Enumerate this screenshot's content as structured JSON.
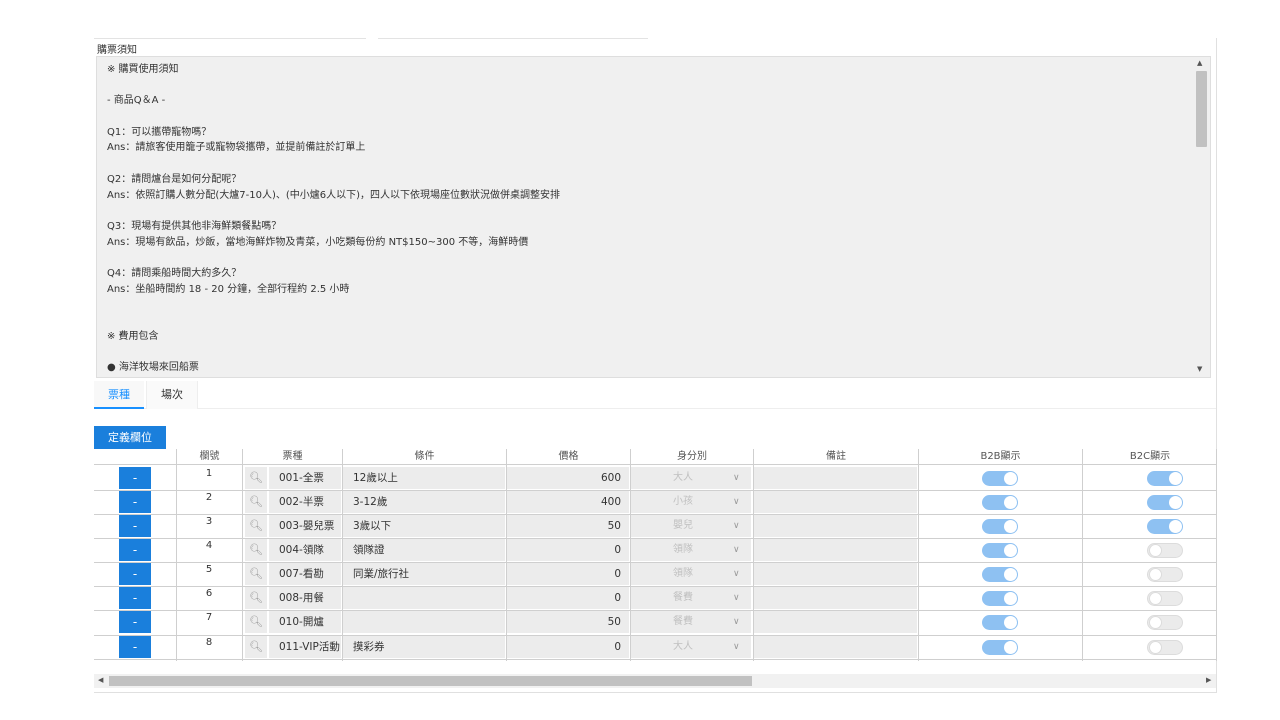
{
  "notice": {
    "label": "購票須知",
    "lines": [
      "※ 購買使用須知",
      "",
      "- 商品Q＆A -",
      "",
      "Q1：可以攜帶寵物嗎？",
      "Ans：請旅客使用籠子或寵物袋攜帶，並提前備註於訂單上",
      "",
      "Q2：請問爐台是如何分配呢？",
      "Ans：依照訂購人數分配(大爐7-10人)、(中小爐6人以下)，四人以下依現場座位數狀況做併桌調整安排",
      "",
      "Q3：現場有提供其他非海鮮類餐點嗎？",
      "Ans：現場有飲品，炒飯，當地海鮮炸物及青菜，小吃類每份約 NT$150~300 不等，海鮮時價",
      "",
      "Q4：請問乘船時間大約多久？",
      "Ans：坐船時間約 18 - 20 分鐘，全部行程約 2.5 小時",
      "",
      "",
      "※ 費用包含",
      "",
      "● 海洋牧場來回船票"
    ]
  },
  "tabs": [
    {
      "label": "票種",
      "active": true
    },
    {
      "label": "場次",
      "active": false
    }
  ],
  "define_button": "定義欄位",
  "columns": [
    "欄號",
    "票種",
    "條件",
    "價格",
    "身分別",
    "備註",
    "B2B顯示",
    "B2C顯示"
  ],
  "delete_label": "-",
  "rows": [
    {
      "num": "1",
      "code": "001-全票",
      "cond": "12歲以上",
      "price": "600",
      "ident": "大人",
      "b2b": true,
      "b2c": true
    },
    {
      "num": "2",
      "code": "002-半票",
      "cond": "3-12歲",
      "price": "400",
      "ident": "小孩",
      "b2b": true,
      "b2c": true
    },
    {
      "num": "3",
      "code": "003-嬰兒票",
      "cond": "3歲以下",
      "price": "50",
      "ident": "嬰兒",
      "b2b": true,
      "b2c": true
    },
    {
      "num": "4",
      "code": "004-領隊",
      "cond": "領隊證",
      "price": "0",
      "ident": "領隊",
      "b2b": true,
      "b2c": false
    },
    {
      "num": "5",
      "code": "007-看勘",
      "cond": "同業/旅行社",
      "price": "0",
      "ident": "領隊",
      "b2b": true,
      "b2c": false
    },
    {
      "num": "6",
      "code": "008-用餐",
      "cond": "",
      "price": "0",
      "ident": "餐費",
      "b2b": true,
      "b2c": false
    },
    {
      "num": "7",
      "code": "010-開爐",
      "cond": "",
      "price": "50",
      "ident": "餐費",
      "b2b": true,
      "b2c": false
    },
    {
      "num": "8",
      "code": "011-VIP活動",
      "cond": "摸彩券",
      "price": "0",
      "ident": "大人",
      "b2b": true,
      "b2c": false
    }
  ],
  "icons": {
    "search": "search-icon",
    "chevron": "chevron-down-icon"
  }
}
